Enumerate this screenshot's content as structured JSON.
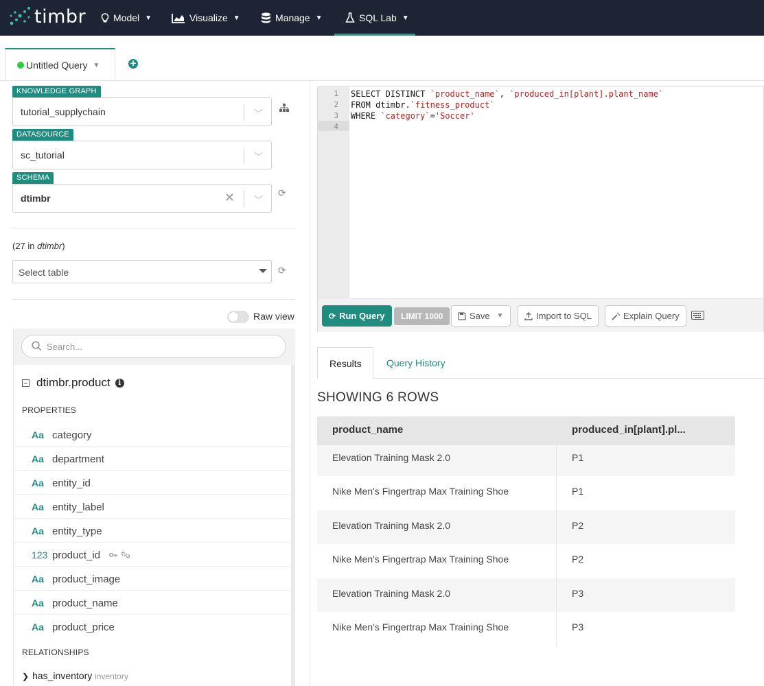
{
  "app": {
    "brand": "timbr",
    "nav": [
      {
        "label": "Model",
        "icon": "bulb-icon"
      },
      {
        "label": "Visualize",
        "icon": "area-chart-icon"
      },
      {
        "label": "Manage",
        "icon": "database-icon"
      },
      {
        "label": "SQL Lab",
        "icon": "flask-icon"
      }
    ],
    "active_nav": "SQL Lab",
    "accent_color": "#1f8c80",
    "navbar_color": "#1d2433"
  },
  "query_tab": {
    "label": "Untitled Query",
    "status_color": "#2ecc40"
  },
  "left": {
    "knowledge_graph": {
      "label": "KNOWLEDGE GRAPH",
      "value": "tutorial_supplychain"
    },
    "datasource": {
      "label": "DATASOURCE",
      "value": "sc_tutorial"
    },
    "schema": {
      "label": "SCHEMA",
      "value": "dtimbr"
    },
    "table_count_prefix": "(27 in ",
    "table_count_schema": "dtimbr",
    "table_count_suffix": ")",
    "table_select_placeholder": "Select table",
    "raw_view_label": "Raw view",
    "search_placeholder": "Search...",
    "tree_title": "dtimbr.product",
    "properties_header": "PROPERTIES",
    "properties": [
      {
        "type": "Aa",
        "name": "category"
      },
      {
        "type": "Aa",
        "name": "department"
      },
      {
        "type": "Aa",
        "name": "entity_id"
      },
      {
        "type": "Aa",
        "name": "entity_label"
      },
      {
        "type": "Aa",
        "name": "entity_type"
      },
      {
        "type": "123",
        "name": "product_id"
      },
      {
        "type": "Aa",
        "name": "product_image"
      },
      {
        "type": "Aa",
        "name": "product_name"
      },
      {
        "type": "Aa",
        "name": "product_price"
      }
    ],
    "relationships_header": "RELATIONSHIPS",
    "relationships": [
      {
        "name": "has_inventory",
        "target": "inventory"
      }
    ]
  },
  "editor": {
    "lines": [
      {
        "n": "1",
        "parts": [
          {
            "t": "SELECT DISTINCT ",
            "s": false
          },
          {
            "t": "`product_name`",
            "s": true
          },
          {
            "t": ", ",
            "s": false
          },
          {
            "t": "`produced_in[plant].plant_name`",
            "s": true
          }
        ]
      },
      {
        "n": "2",
        "parts": [
          {
            "t": "FROM dtimbr.",
            "s": false
          },
          {
            "t": "`fitness_product`",
            "s": true
          }
        ]
      },
      {
        "n": "3",
        "parts": [
          {
            "t": "WHERE ",
            "s": false
          },
          {
            "t": "`category`",
            "s": true
          },
          {
            "t": "=",
            "s": false
          },
          {
            "t": "'Soccer'",
            "s": true
          }
        ]
      },
      {
        "n": "4",
        "parts": []
      }
    ]
  },
  "toolbar": {
    "run_label": "Run Query",
    "limit_label": "LIMIT 1000",
    "save_label": "Save",
    "import_label": "Import to SQL",
    "explain_label": "Explain Query"
  },
  "results": {
    "tabs": [
      "Results",
      "Query History"
    ],
    "rows_title": "SHOWING 6 ROWS",
    "columns": [
      "product_name",
      "produced_in[plant].pl..."
    ],
    "rows": [
      [
        "Elevation Training Mask 2.0",
        "P1"
      ],
      [
        "Nike Men's Fingertrap Max Training Shoe",
        "P1"
      ],
      [
        "Elevation Training Mask 2.0",
        "P2"
      ],
      [
        "Nike Men's Fingertrap Max Training Shoe",
        "P2"
      ],
      [
        "Elevation Training Mask 2.0",
        "P3"
      ],
      [
        "Nike Men's Fingertrap Max Training Shoe",
        "P3"
      ]
    ]
  }
}
